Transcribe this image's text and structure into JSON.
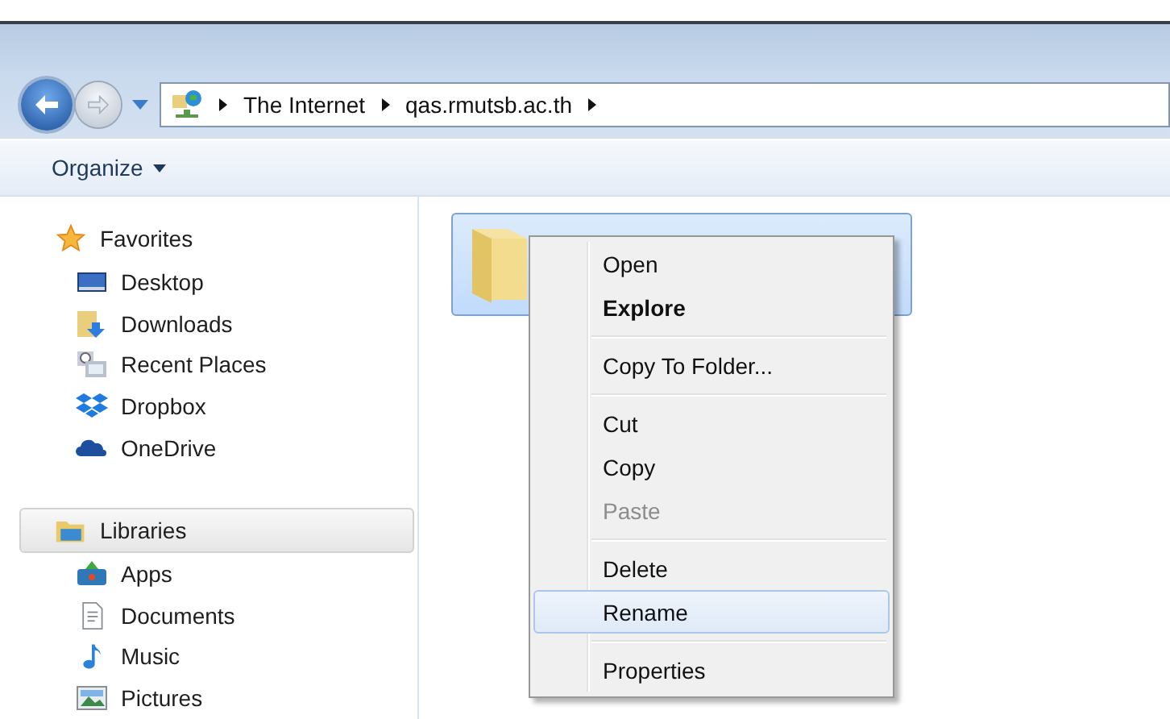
{
  "address_bar": {
    "segments": [
      "The Internet",
      "qas.rmutsb.ac.th"
    ]
  },
  "toolbar": {
    "organize": "Organize"
  },
  "sidebar": {
    "sections": [
      {
        "title": "Favorites",
        "selected": false,
        "items": [
          "Desktop",
          "Downloads",
          "Recent Places",
          "Dropbox",
          "OneDrive"
        ]
      },
      {
        "title": "Libraries",
        "selected": true,
        "items": [
          "Apps",
          "Documents",
          "Music",
          "Pictures"
        ]
      }
    ]
  },
  "content": {
    "folder": {
      "selected": true
    }
  },
  "context_menu": {
    "items": [
      {
        "kind": "item",
        "label": "Open",
        "bold": false,
        "disabled": false,
        "selected": false
      },
      {
        "kind": "item",
        "label": "Explore",
        "bold": true,
        "disabled": false,
        "selected": false
      },
      {
        "kind": "separator"
      },
      {
        "kind": "item",
        "label": "Copy To Folder...",
        "bold": false,
        "disabled": false,
        "selected": false
      },
      {
        "kind": "separator"
      },
      {
        "kind": "item",
        "label": "Cut",
        "bold": false,
        "disabled": false,
        "selected": false
      },
      {
        "kind": "item",
        "label": "Copy",
        "bold": false,
        "disabled": false,
        "selected": false
      },
      {
        "kind": "item",
        "label": "Paste",
        "bold": false,
        "disabled": true,
        "selected": false
      },
      {
        "kind": "separator"
      },
      {
        "kind": "item",
        "label": "Delete",
        "bold": false,
        "disabled": false,
        "selected": false
      },
      {
        "kind": "item",
        "label": "Rename",
        "bold": false,
        "disabled": false,
        "selected": true
      },
      {
        "kind": "separator"
      },
      {
        "kind": "item",
        "label": "Properties",
        "bold": false,
        "disabled": false,
        "selected": false
      }
    ]
  }
}
